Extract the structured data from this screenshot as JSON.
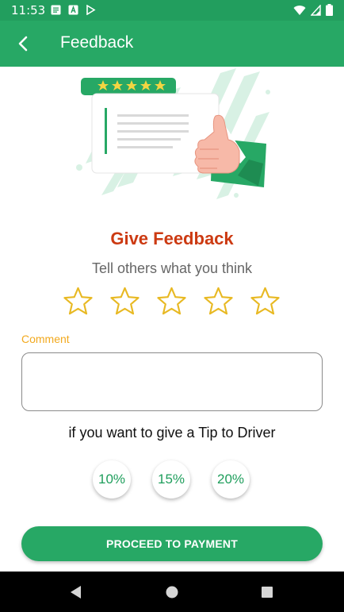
{
  "status_bar": {
    "time": "11:53",
    "left_icons": [
      "notes-icon",
      "a-icon",
      "play-store-icon"
    ],
    "right_icons": [
      "wifi-icon",
      "signal-icon",
      "battery-icon"
    ]
  },
  "app_bar": {
    "back_icon": "back-arrow-icon",
    "title": "Feedback"
  },
  "main": {
    "illustration": "thumbs-up-review-illustration",
    "title": "Give Feedback",
    "subtitle": "Tell others what you think",
    "rating": {
      "max": 5,
      "value": 0
    },
    "comment": {
      "label": "Comment",
      "value": "",
      "placeholder": ""
    },
    "tip_prompt": "if you want to give a Tip to Driver",
    "tip_options": [
      "10%",
      "15%",
      "20%"
    ],
    "proceed_label": "PROCEED TO PAYMENT"
  },
  "nav_bar": {
    "buttons": [
      "back-triangle-icon",
      "home-circle-icon",
      "recents-square-icon"
    ]
  },
  "colors": {
    "primary": "#27a865",
    "status_bar": "#229e5e",
    "title": "#cc3a12",
    "star": "#e8b923",
    "comment_label": "#f2a91e"
  }
}
